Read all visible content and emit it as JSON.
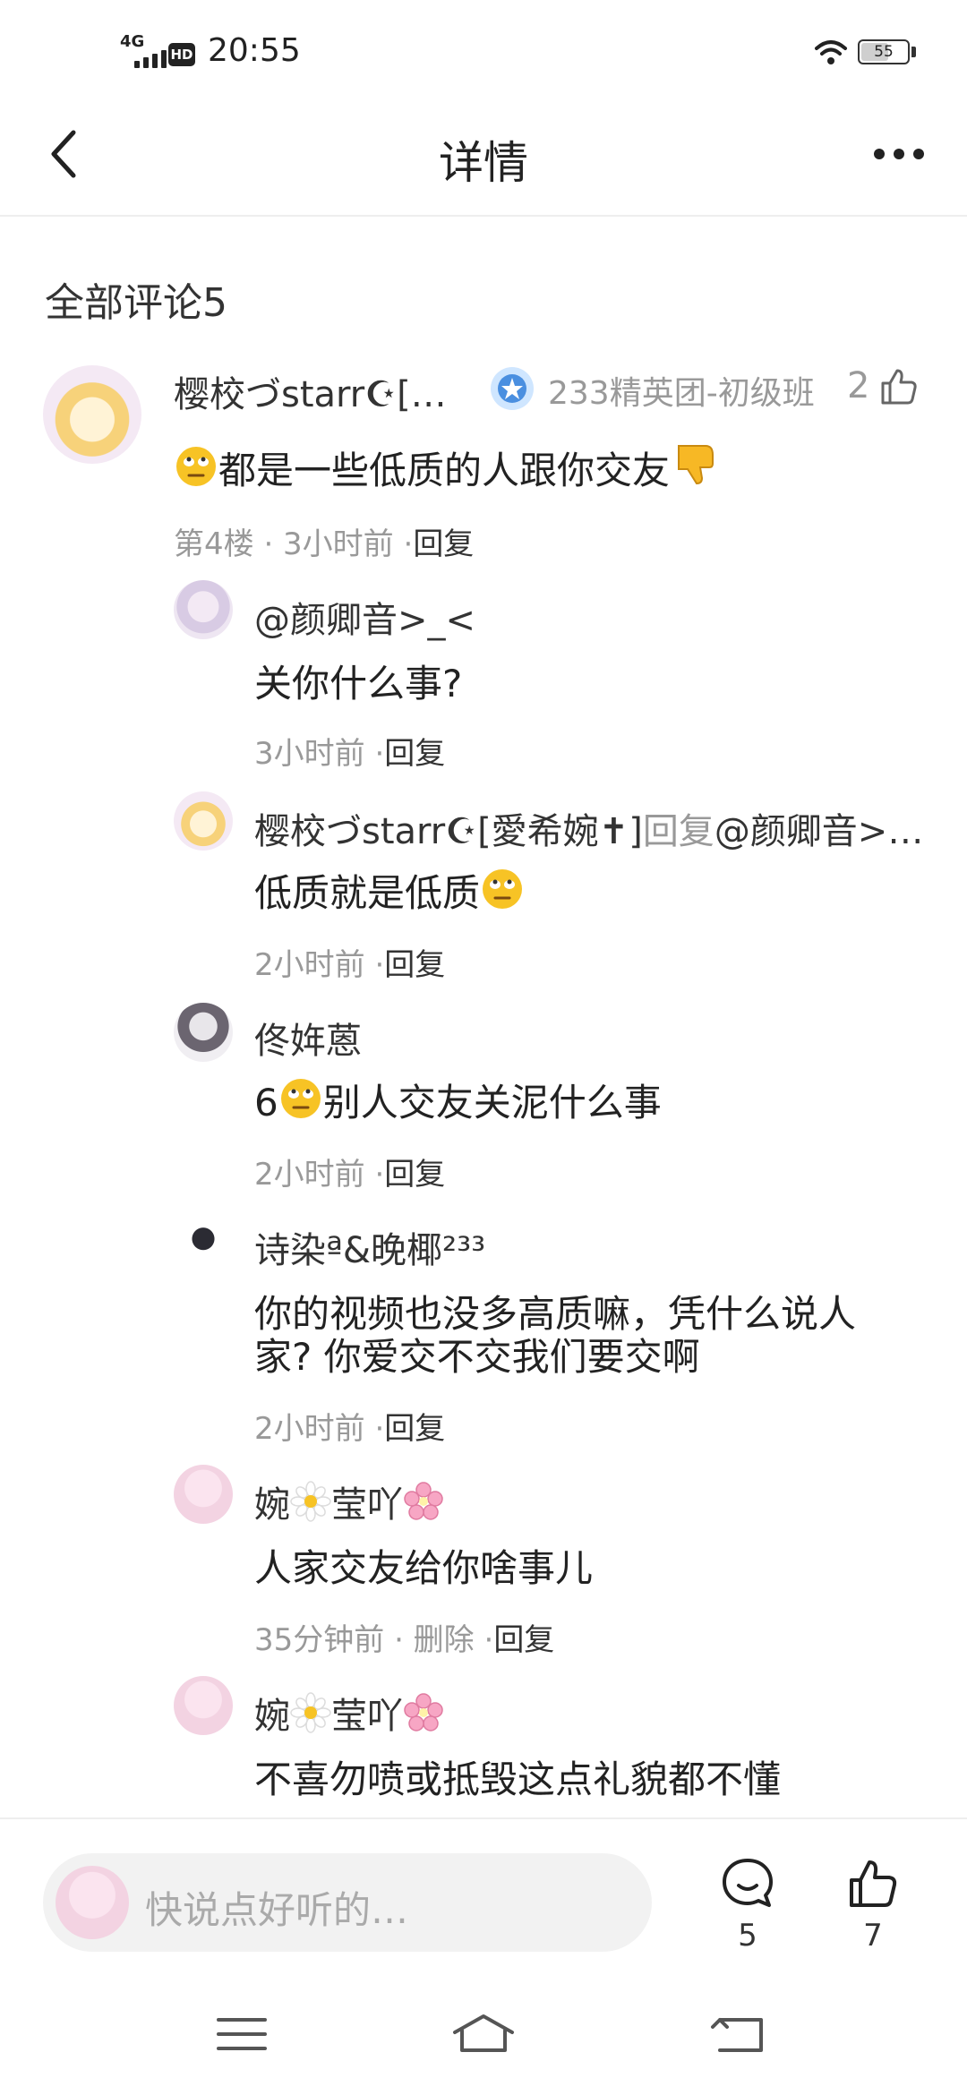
{
  "status_bar": {
    "network": "4G",
    "hd": "HD",
    "time": "20:55",
    "battery": "55"
  },
  "header": {
    "title": "详情"
  },
  "section": {
    "title": "全部评论5"
  },
  "main_comment": {
    "author": "樱校づstarr☪[…",
    "badge": "233精英团-初级班",
    "likes": "2",
    "text": "都是一些低质的人跟你交友",
    "meta": "第4楼 · 3小时前 ·",
    "reply": "回复"
  },
  "replies": [
    {
      "author": "@颜卿音>_<",
      "text": "关你什么事?",
      "meta": "3小时前 ·",
      "reply": "回复"
    },
    {
      "author": "樱校づstarr☪[愛希婉✝]",
      "reply_label": "回复",
      "reply_target": "@颜卿音>…",
      "text": "低质就是低质",
      "meta": "2小时前 ·",
      "reply": "回复"
    },
    {
      "author": "佟姩蒽",
      "text_pre": "6",
      "text": "别人交友关泥什么事",
      "meta": "2小时前 ·",
      "reply": "回复"
    },
    {
      "author": "诗染ª&晚椰²³³",
      "text_line1": "你的视频也没多高质嘛，凭什么说人",
      "text_line2": "家? 你爱交不交我们要交啊",
      "meta": "2小时前 ·",
      "reply": "回复"
    },
    {
      "author": "婉",
      "author_mid": "莹吖",
      "text": "人家交友给你啥事儿",
      "meta": "35分钟前 · 删除 ·",
      "reply": "回复"
    },
    {
      "author": "婉",
      "author_mid": "莹吖",
      "text": "不喜勿喷或抵毁这点礼貌都不懂"
    }
  ],
  "bottom_bar": {
    "placeholder": "快说点好听的…",
    "comment_count": "5",
    "like_count": "7"
  },
  "colors": {
    "muted": "#999999",
    "text": "#222222",
    "accent_blue": "#4a8fe0",
    "emoji_yellow": "#f7c325"
  }
}
